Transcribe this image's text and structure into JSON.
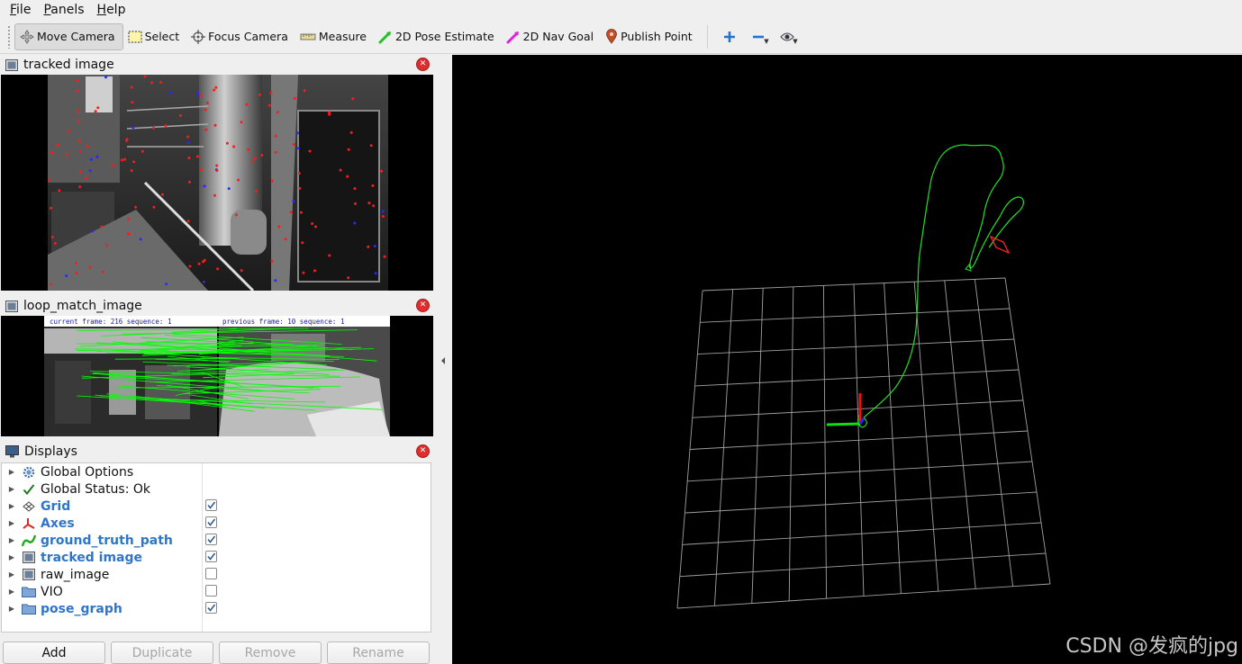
{
  "menu": [
    {
      "label": "File",
      "accel": "F",
      "rest": "ile"
    },
    {
      "label": "Panels",
      "accel": "P",
      "rest": "anels"
    },
    {
      "label": "Help",
      "accel": "H",
      "rest": "elp"
    }
  ],
  "toolbar": {
    "move_camera": "Move Camera",
    "select": "Select",
    "focus_camera": "Focus Camera",
    "measure": "Measure",
    "pose_estimate": "2D Pose Estimate",
    "nav_goal": "2D Nav Goal",
    "publish_point": "Publish Point"
  },
  "panels": {
    "tracked": {
      "title": "tracked image"
    },
    "loop": {
      "title": "loop_match_image",
      "current_label": "current frame: 216   sequence: 1",
      "previous_label": "previous frame: 10   sequence: 1"
    },
    "displays": {
      "title": "Displays"
    }
  },
  "displays": {
    "items": [
      {
        "label": "Global Options",
        "icon": "gear-icon",
        "bold": false,
        "checked": null
      },
      {
        "label": "Global Status: Ok",
        "icon": "checkmark-icon",
        "bold": false,
        "checked": null
      },
      {
        "label": "Grid",
        "icon": "grid-icon",
        "bold": true,
        "checked": true
      },
      {
        "label": "Axes",
        "icon": "axes-icon",
        "bold": true,
        "checked": true
      },
      {
        "label": "ground_truth_path",
        "icon": "path-icon",
        "bold": true,
        "checked": true
      },
      {
        "label": "tracked image",
        "icon": "image-icon",
        "bold": true,
        "checked": true
      },
      {
        "label": "raw_image",
        "icon": "image-icon",
        "bold": false,
        "checked": false
      },
      {
        "label": "VIO",
        "icon": "folder-icon",
        "bold": false,
        "checked": false
      },
      {
        "label": "pose_graph",
        "icon": "folder-icon",
        "bold": true,
        "checked": true
      }
    ]
  },
  "buttons": {
    "add": "Add",
    "duplicate": "Duplicate",
    "remove": "Remove",
    "rename": "Rename"
  },
  "watermark": "CSDN @发疯的jpg",
  "colors": {
    "trajectory": "#22e022",
    "grid": "#a0a0a0",
    "feature_red": "#ff1a1a",
    "feature_blue": "#2828ff",
    "match_green": "#00ff00",
    "bold_label": "#2f75c9"
  }
}
